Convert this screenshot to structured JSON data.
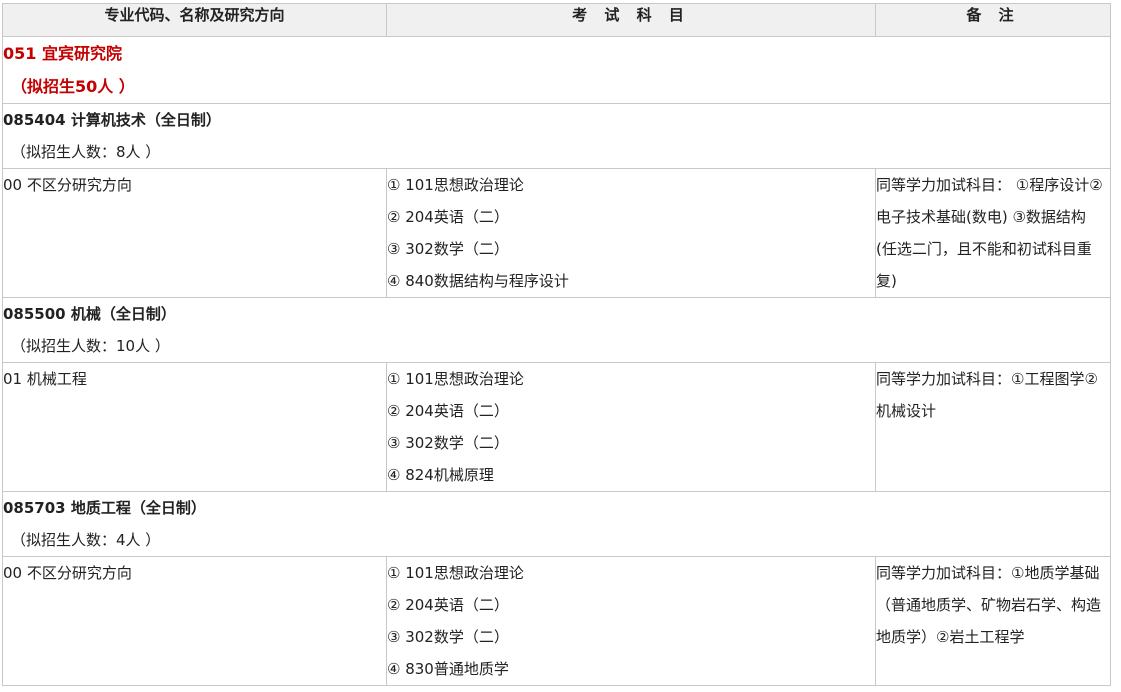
{
  "header": {
    "col1": "专业代码、名称及研究方向",
    "col2": "考 试 科 目",
    "col3": "备 注"
  },
  "college": {
    "name": "051 宜宾研究院",
    "quota": "（拟招生50人 ）"
  },
  "majors": [
    {
      "title": "085404 计算机技术（全日制）",
      "quota": "（拟招生人数：8人 ）",
      "direction": "00 不区分研究方向",
      "exams": [
        "① 101思想政治理论",
        "② 204英语（二）",
        "③ 302数学（二）",
        "④ 840数据结构与程序设计"
      ],
      "note": "同等学力加试科目：  ①程序设计②电子技术基础(数电) ③数据结构 (任选二门，且不能和初试科目重复)"
    },
    {
      "title": "085500 机械（全日制）",
      "quota": "（拟招生人数：10人 ）",
      "direction": "01 机械工程",
      "exams": [
        "① 101思想政治理论",
        "② 204英语（二）",
        "③ 302数学（二）",
        "④ 824机械原理"
      ],
      "note": "同等学力加试科目：①工程图学②机械设计"
    },
    {
      "title": "085703 地质工程（全日制）",
      "quota": "（拟招生人数：4人 ）",
      "direction": "00 不区分研究方向",
      "exams": [
        "① 101思想政治理论",
        "② 204英语（二）",
        "③ 302数学（二）",
        "④ 830普通地质学"
      ],
      "note": "同等学力加试科目：①地质学基础（普通地质学、矿物岩石学、构造地质学）②岩土工程学"
    }
  ]
}
